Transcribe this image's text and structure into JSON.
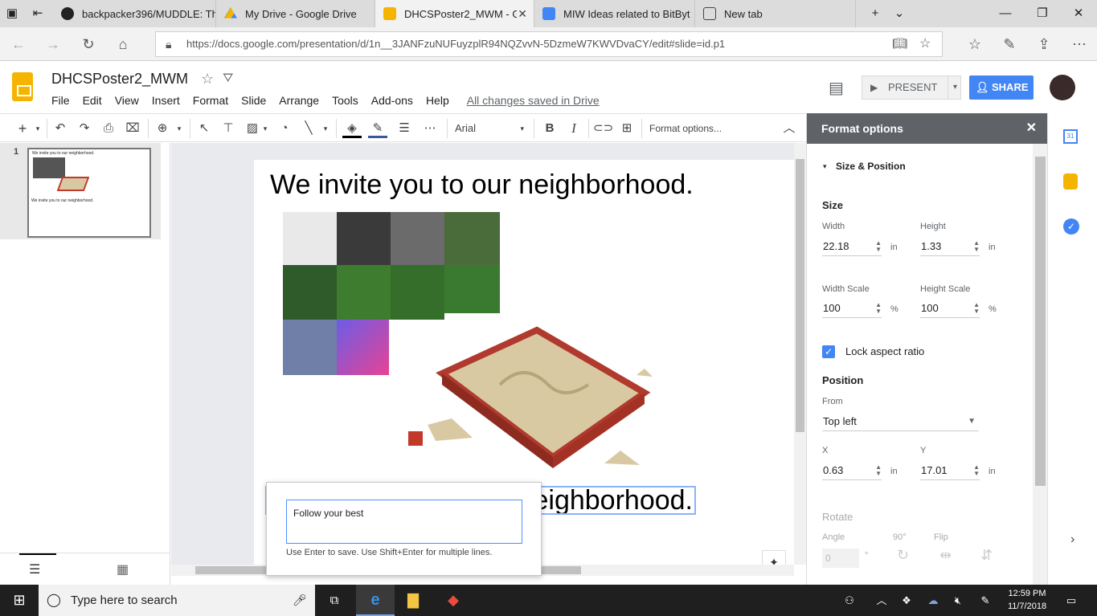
{
  "browser": {
    "tabs": [
      {
        "label": "backpacker396/MUDDLE: Th",
        "icon": "github-icon"
      },
      {
        "label": "My Drive - Google Drive",
        "icon": "drive-icon"
      },
      {
        "label": "DHCSPoster2_MWM - G",
        "icon": "slides-icon",
        "active": true
      },
      {
        "label": "MIW Ideas related to BitByt",
        "icon": "docs-icon"
      },
      {
        "label": "New tab",
        "icon": "newtab-icon"
      }
    ],
    "url": "https://docs.google.com/presentation/d/1n__3JANFzuNUFuyzplR94NQZvvN-5DzmeW7KWVDvaCY/edit#slide=id.p1"
  },
  "docs": {
    "title": "DHCSPoster2_MWM",
    "menus": [
      "File",
      "Edit",
      "View",
      "Insert",
      "Format",
      "Slide",
      "Arrange",
      "Tools",
      "Add-ons",
      "Help"
    ],
    "saved_status": "All changes saved in Drive",
    "present_label": "PRESENT",
    "share_label": "SHARE"
  },
  "toolbar": {
    "font": "Arial",
    "format_options_label": "Format options..."
  },
  "filmstrip": {
    "slide_number": "1",
    "thumb_title": "We invite you to our neighborhood.",
    "thumb_bottom": "We invite you to our neighborhood."
  },
  "slide": {
    "title": "We invite you to our neighborhood.",
    "bottom_text_visible": "eighborhood."
  },
  "alt_text_popup": {
    "value": "Follow your best",
    "hint": "Use Enter to save. Use Shift+Enter for multiple lines."
  },
  "format_panel": {
    "header": "Format options",
    "section": "Size & Position",
    "size_heading": "Size",
    "width_label": "Width",
    "width_value": "22.18",
    "height_label": "Height",
    "height_value": "1.33",
    "unit": "in",
    "width_scale_label": "Width Scale",
    "width_scale_value": "100",
    "height_scale_label": "Height Scale",
    "height_scale_value": "100",
    "percent": "%",
    "lock_label": "Lock aspect ratio",
    "lock_checked": true,
    "position_heading": "Position",
    "from_label": "From",
    "from_value": "Top left",
    "x_label": "X",
    "x_value": "0.63",
    "y_label": "Y",
    "y_value": "17.01",
    "rotate_heading": "Rotate",
    "angle_label": "Angle",
    "angle_value": "0",
    "degree": "°",
    "rot90_label": "90°",
    "flip_label": "Flip"
  },
  "taskbar": {
    "search_placeholder": "Type here to search",
    "time": "12:59 PM",
    "date": "11/7/2018"
  },
  "colors": {
    "share_blue": "#4285f4",
    "slides_yellow": "#f4b400",
    "sandbox_red": "#c0392b",
    "sand": "#d9c9a3"
  }
}
